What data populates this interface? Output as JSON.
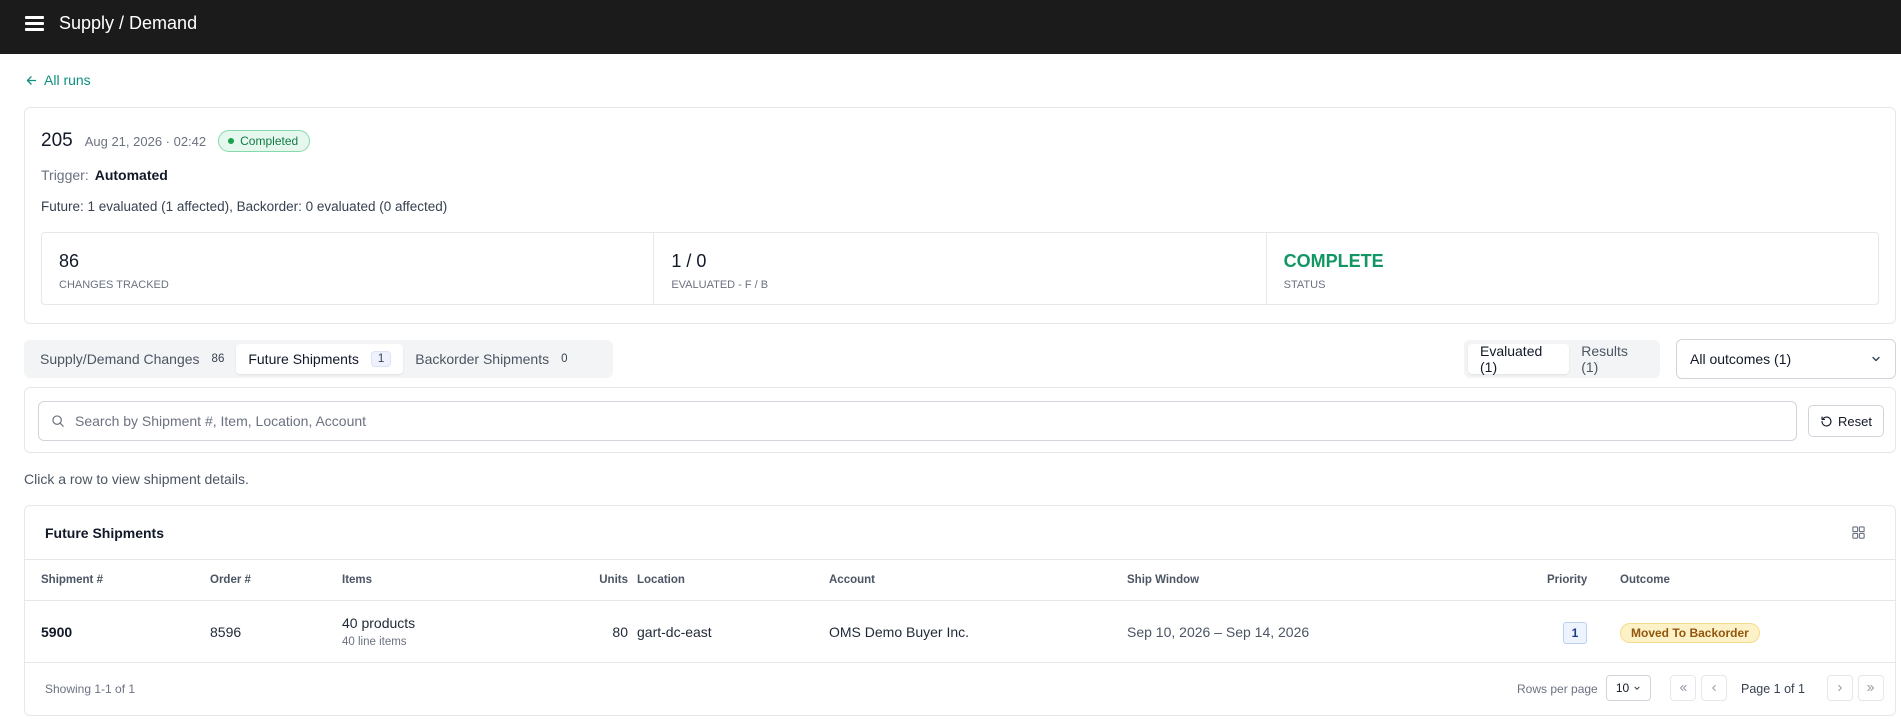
{
  "header": {
    "title": "Supply / Demand"
  },
  "nav": {
    "back_label": "All runs"
  },
  "run": {
    "id": "205",
    "datetime": "Aug 21, 2026 · 02:42",
    "status": "Completed",
    "trigger_label": "Trigger:",
    "trigger_value": "Automated",
    "summary": "Future: 1 evaluated (1 affected), Backorder: 0 evaluated (0 affected)",
    "stats": [
      {
        "value": "86",
        "label": "CHANGES TRACKED"
      },
      {
        "value": "1 / 0",
        "label": "EVALUATED - F / B"
      },
      {
        "value": "COMPLETE",
        "label": "STATUS"
      }
    ]
  },
  "tabs": [
    {
      "label": "Supply/Demand Changes",
      "count": "86"
    },
    {
      "label": "Future Shipments",
      "count": "1"
    },
    {
      "label": "Backorder Shipments",
      "count": "0"
    }
  ],
  "view_toggle": {
    "evaluated": "Evaluated (1)",
    "results": "Results (1)"
  },
  "outcome_filter": {
    "selected": "All outcomes (1)"
  },
  "search": {
    "placeholder": "Search by Shipment #, Item, Location, Account",
    "value": ""
  },
  "reset_label": "Reset",
  "hint": "Click a row to view shipment details.",
  "table": {
    "title": "Future Shipments",
    "columns": {
      "shipment": "Shipment #",
      "order": "Order #",
      "items": "Items",
      "units": "Units",
      "location": "Location",
      "account": "Account",
      "ship_window": "Ship Window",
      "priority": "Priority",
      "outcome": "Outcome"
    },
    "rows": [
      {
        "shipment": "5900",
        "order": "8596",
        "items": "40 products",
        "items_sub": "40 line items",
        "units": "80",
        "location": "gart-dc-east",
        "account": "OMS Demo Buyer Inc.",
        "ship_window": "Sep 10, 2026 – Sep 14, 2026",
        "priority": "1",
        "outcome": "Moved To Backorder"
      }
    ]
  },
  "footer": {
    "showing": "Showing 1-1 of 1",
    "rows_per_page_label": "Rows per page",
    "rows_per_page": "10",
    "page_info": "Page 1 of 1"
  },
  "icons": {
    "menu": "hamburger-icon",
    "back": "arrow-left-icon",
    "search": "search-icon",
    "reset": "rotate-ccw-icon",
    "grid": "grid-icon",
    "chevron": "chevron-down-icon"
  },
  "colors": {
    "topbar": "#1b1b1b",
    "accent": "#0f8f7d",
    "complete_green": "#119664",
    "status_pill_bg": "#e6f8ee",
    "outcome_badge_bg": "#fdf1c7"
  }
}
